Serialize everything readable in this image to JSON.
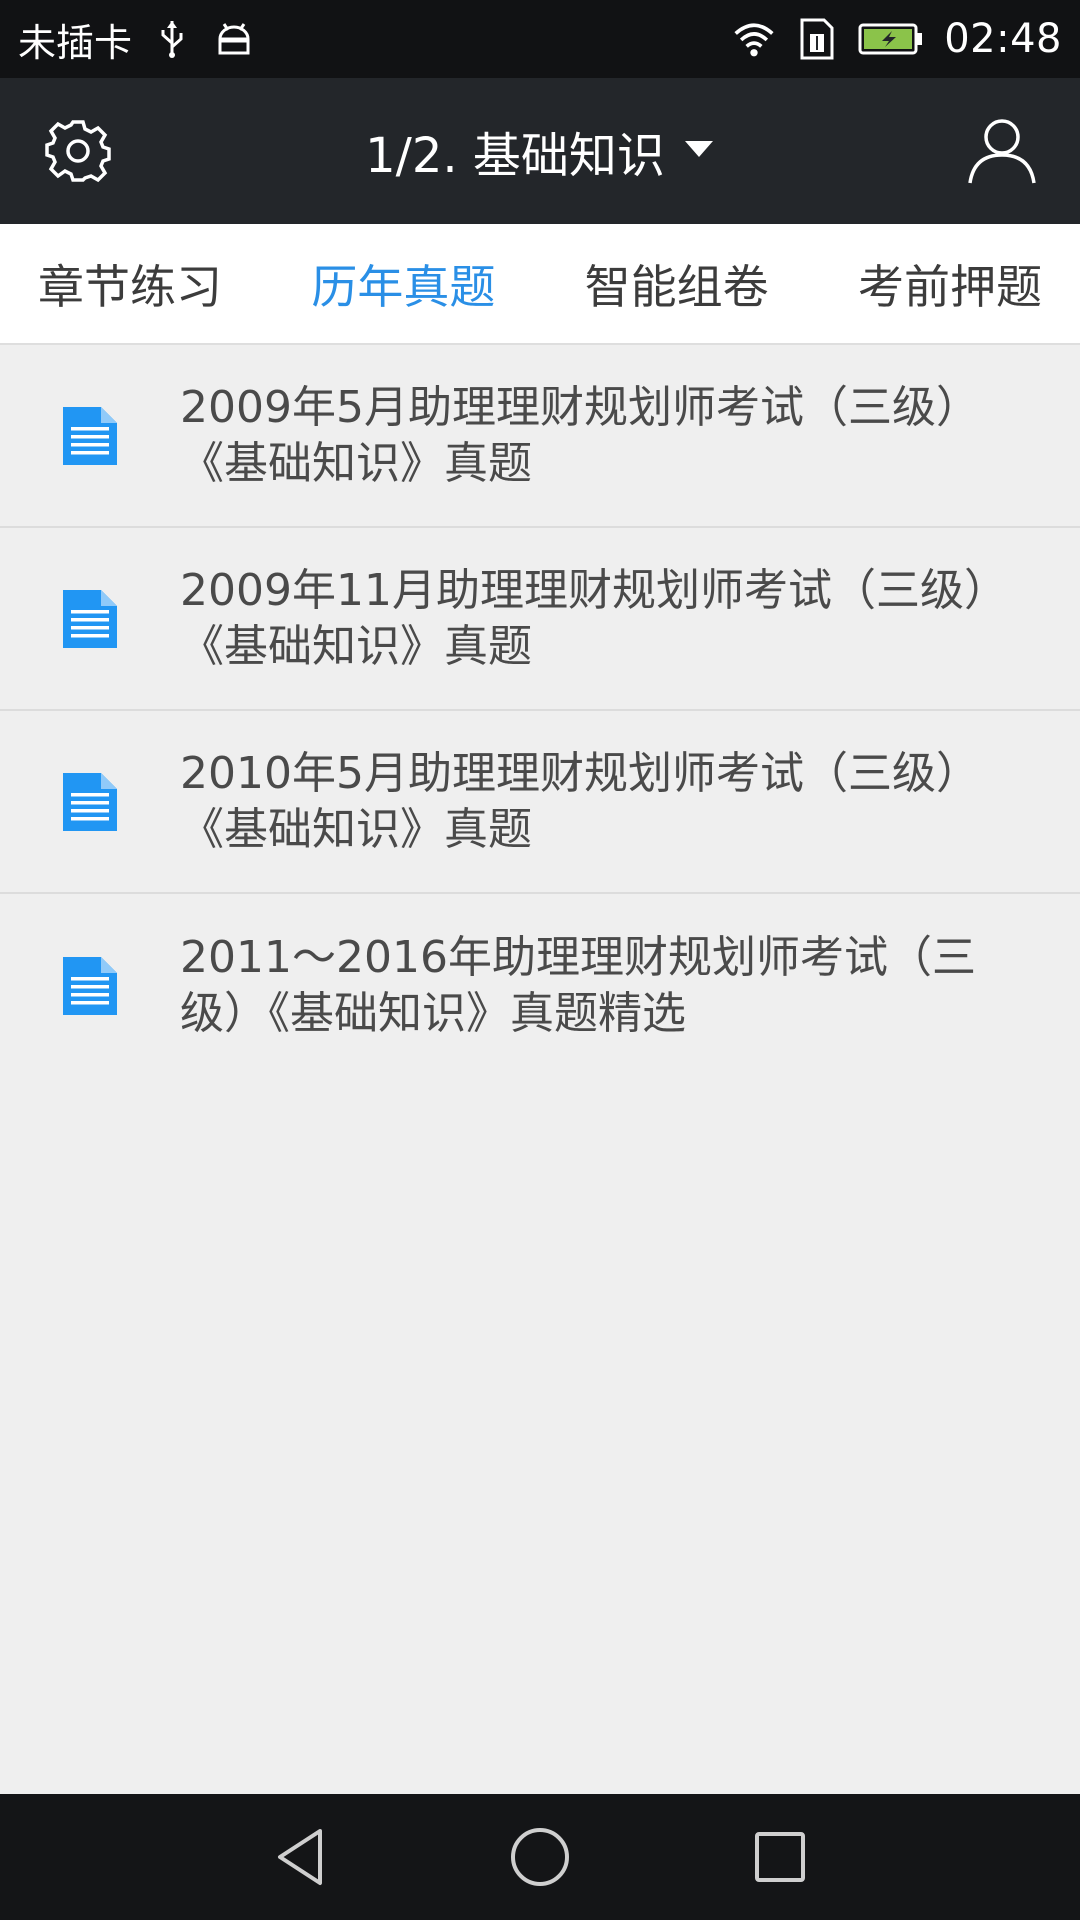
{
  "status_bar": {
    "carrier": "未插卡",
    "time": "02:48",
    "icons": [
      "usb-icon",
      "android-debug-icon",
      "wifi-icon",
      "sim-icon",
      "battery-charging-icon"
    ],
    "battery_color": "#8bc34a"
  },
  "app_bar": {
    "title": "1/2. 基础知识",
    "left_icon": "settings-gear-icon",
    "right_icon": "user-profile-icon",
    "dropdown_icon": "caret-down-icon"
  },
  "tabs": [
    {
      "label": "章节练习",
      "active": false
    },
    {
      "label": "历年真题",
      "active": true
    },
    {
      "label": "智能组卷",
      "active": false
    },
    {
      "label": "考前押题",
      "active": false
    }
  ],
  "accent_color": "#2a8fe6",
  "list": [
    {
      "title": "2009年5月助理理财规划师考试（三级）《基础知识》真题",
      "icon": "document-icon"
    },
    {
      "title": "2009年11月助理理财规划师考试（三级）《基础知识》真题",
      "icon": "document-icon"
    },
    {
      "title": "2010年5月助理理财规划师考试（三级）《基础知识》真题",
      "icon": "document-icon"
    },
    {
      "title": "2011～2016年助理理财规划师考试（三级）《基础知识》真题精选",
      "icon": "document-icon"
    }
  ],
  "nav_bar": {
    "icons": [
      "back-icon",
      "home-icon",
      "recents-icon"
    ]
  }
}
